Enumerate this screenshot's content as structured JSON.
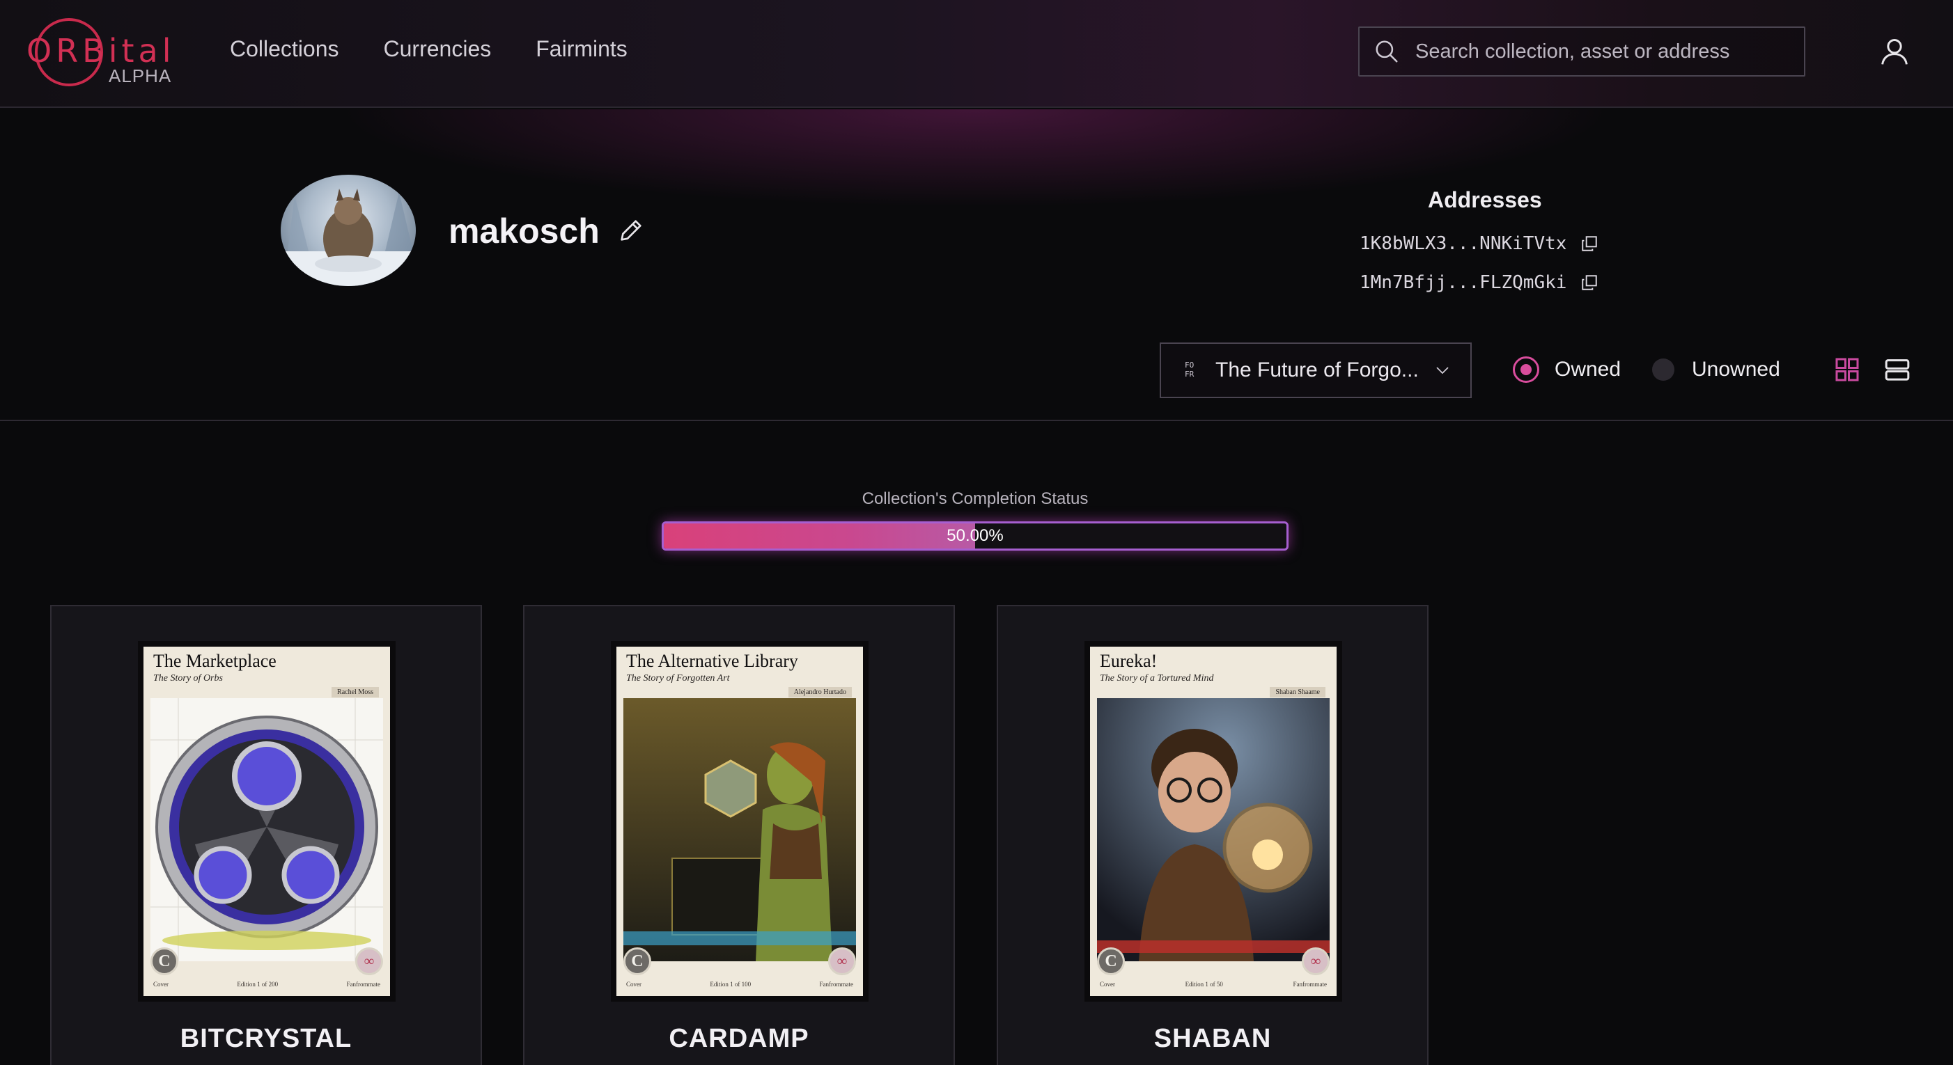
{
  "brand": {
    "logo_word": "ORBital",
    "logo_tag": "ALPHA",
    "accent_color": "#d23054"
  },
  "nav": {
    "items": [
      {
        "label": "Collections"
      },
      {
        "label": "Currencies"
      },
      {
        "label": "Fairmints"
      }
    ]
  },
  "search": {
    "placeholder": "Search collection, asset or address",
    "value": ""
  },
  "profile": {
    "username": "makosch",
    "addresses_title": "Addresses",
    "addresses": [
      {
        "short": "1K8bWLX3...NNKiTVtx"
      },
      {
        "short": "1Mn7Bfjj...FLZQmGki"
      }
    ]
  },
  "filters": {
    "collection_badge_line1": "FO",
    "collection_badge_line2": "FR",
    "collection_selected": "The Future of Forgo...",
    "ownership_options": [
      {
        "label": "Owned",
        "selected": true
      },
      {
        "label": "Unowned",
        "selected": false
      }
    ],
    "view_mode": "grid"
  },
  "completion": {
    "label": "Collection's Completion Status",
    "percent": 50.0,
    "percent_text": "50.00%",
    "bar_color": "#d9417a",
    "border_color": "#a65fd0"
  },
  "cards": [
    {
      "name": "BITCRYSTAL",
      "title": "The Marketplace",
      "subtitle": "The Story of Orbs",
      "artist": "Rachel Moss",
      "edition": "Edition 1 of 200",
      "rarity_left": "Cover",
      "rarity_right": "Fanfrommate",
      "art_color": "#4b3fb5"
    },
    {
      "name": "CARDAMP",
      "title": "The Alternative Library",
      "subtitle": "The Story of Forgotten Art",
      "artist": "Alejandro Hurtado",
      "edition": "Edition 1 of 100",
      "rarity_left": "Cover",
      "rarity_right": "Fanfrommate",
      "art_color": "#6a7a30"
    },
    {
      "name": "SHABAN",
      "title": "Eureka!",
      "subtitle": "The Story of a Tortured Mind",
      "artist": "Shaban Shaame",
      "edition": "Edition 1 of 50",
      "rarity_left": "Cover",
      "rarity_right": "Fanfrommate",
      "art_color": "#6b4a2a"
    }
  ]
}
